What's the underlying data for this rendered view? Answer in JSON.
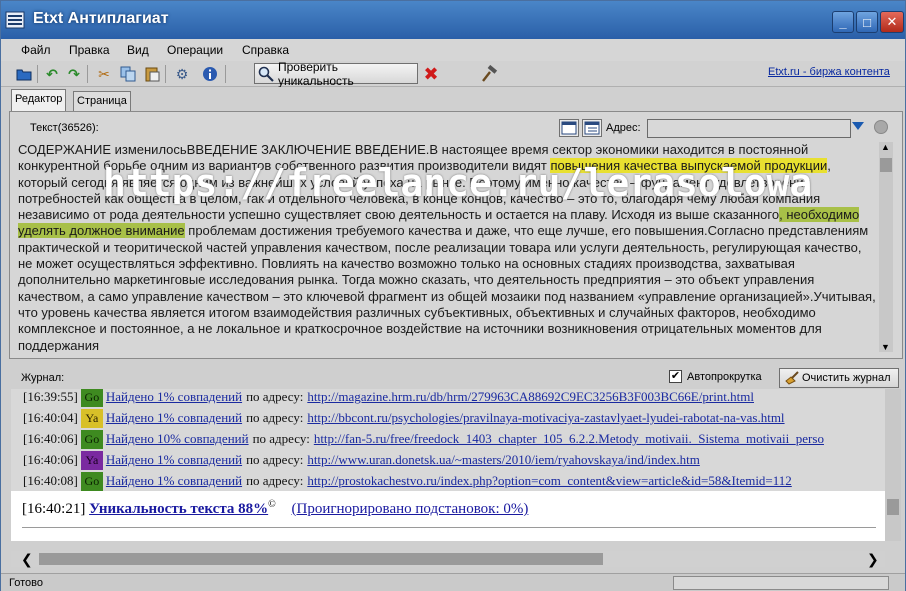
{
  "window": {
    "title": "Etxt Антиплагиат"
  },
  "menu": [
    "Файл",
    "Правка",
    "Вид",
    "Операции",
    "Справка"
  ],
  "toolbar": {
    "icons": [
      "open-folder-icon",
      "undo-icon",
      "redo-icon",
      "cut-icon",
      "copy-icon",
      "paste-icon",
      "settings-icon",
      "info-icon",
      "magnifier-icon",
      "stop-icon",
      "hammer-icon"
    ],
    "check_label": "Проверить уникальность",
    "link": "Etxt.ru - биржа контента"
  },
  "tabs": [
    "Редактор",
    "Страница"
  ],
  "editor": {
    "count_label": "Текст(36526):",
    "address_label": "Адрес:",
    "address_value": "",
    "text_parts": [
      "СОДЕРЖАНИЕ изменилосьВВЕДЕНИЕ ЗАКЛЮЧЕНИЕ ВВЕДЕНИЕ.В настоящее время сектор экономики находится в постоянной конкурентной борьбе одним из вариантов собственного развития производители видят ",
      "повышения качества выпускаемой продукции",
      ", который сегодня является одним из важнейших условий успеха на рынке. Поэтому именно качество – фундамент удовлетворения потребностей как общества в целом, так и отдельного человека, в конце концов, качество – это то, благодаря чему любая компания независимо от рода деятельности успешно существляет свою деятельность и остается на плаву. Исходя из выше сказанного",
      ", необходимо уделять должное внимание",
      " проблемам достижения требуемого качества и даже, что еще лучше, его повышения.Согласно представлениям практической и теоритической частей управления качеством, после реализации товара или услуги деятельность, регулирующая качество, не может осуществляться эффективно. Повлиять на качество возможно только на основных стадиях производства, захватывая дополнительно маркетинговые исследования рынка. Тогда можно сказать, что деятельность предприятия – это объект управления качеством, а само управление качеством – это ключевой фрагмент из общей мозаики под названием «управление организацией».Учитывая, что уровень качества является итогом взаимодействия различных субъективных, объективных и случайных факторов, необходимо комплексное и постоянное, а не локальное и краткосрочное воздействие на источники возникновения отрицательных моментов для поддержания"
    ]
  },
  "journal": {
    "label": "Журнал:",
    "autoscroll_label": "Автопрокрутка",
    "autoscroll_checked": "✔",
    "clear_label": "Очистить журнал",
    "entries": [
      {
        "time": "[16:39:55]",
        "src": "Go",
        "found": "Найдено 1% совпадений",
        "by": "по адресу:",
        "url": "http://magazine.hrm.ru/db/hrm/279963CA88692C9EC3256B3F003BC66E/print.html"
      },
      {
        "time": "[16:40:04]",
        "src": "Ya",
        "found": "Найдено 1% совпадений",
        "by": "по адресу:",
        "url": "http://bbcont.ru/psychologies/pravilnaya-motivaciya-zastavlyaet-lyudei-rabotat-na-vas.html"
      },
      {
        "time": "[16:40:06]",
        "src": "Go",
        "found": "Найдено 10% совпадений",
        "by": "по адресу:",
        "url": "http://fan-5.ru/free/freedock_1403_chapter_105_6.2.2.Metody_motivaii._Sistema_motivaii_perso"
      },
      {
        "time": "[16:40:06]",
        "src": "Ya",
        "found": "Найдено 1% совпадений",
        "by": "по адресу:",
        "url": "http://www.uran.donetsk.ua/~masters/2010/iem/ryahovskaya/ind/index.htm"
      },
      {
        "time": "[16:40:08]",
        "src": "Go",
        "found": "Найдено 1% совпадений",
        "by": "по адресу:",
        "url": "http://prostokachestvo.ru/index.php?option=com_content&view=article&id=58&Itemid=112"
      }
    ],
    "result": {
      "time": "[16:40:21]",
      "main": "Уникальность текста 88%",
      "sup": "©",
      "ignored": "(Проигнорировано подстановок: 0%)"
    }
  },
  "status": {
    "text": "Готово"
  },
  "watermark": "https://freelance.ru/lerasolowa",
  "colors": {
    "titlebar": "#2a5fa8",
    "highlight_yellow": "#e8e030",
    "highlight_green": "#a8c048",
    "link": "#1a2aa0"
  }
}
